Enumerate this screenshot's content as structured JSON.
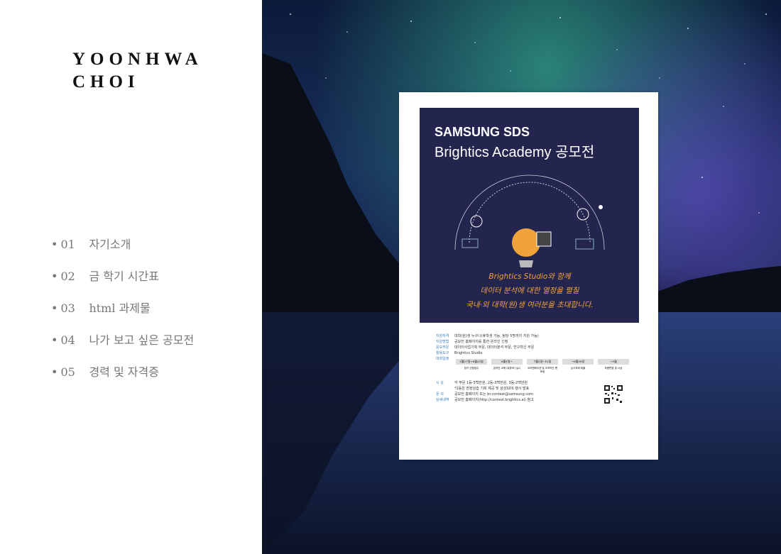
{
  "sidebar": {
    "logo_line1": "YOONHWA",
    "logo_line2": "CHOI",
    "menu": [
      {
        "bullet": "•",
        "num": "01",
        "label": "자기소개"
      },
      {
        "bullet": "•",
        "num": "02",
        "label": "금 학기 시간표"
      },
      {
        "bullet": "•",
        "num": "03",
        "label": "html 과제물"
      },
      {
        "bullet": "•",
        "num": "04",
        "label": "나가 보고 싶은 공모전"
      },
      {
        "bullet": "•",
        "num": "05",
        "label": "경력 및 자격증"
      }
    ]
  },
  "poster": {
    "brand": "SAMSUNG SDS",
    "title": "Brightics Academy 공모전",
    "slogan_line1": "Brightics Studio와 함께",
    "slogan_line2": "데이터 분석에 대한 열정을 펼칠",
    "slogan_line3": "국내·외 대학(원)생 여러분을 초대합니다.",
    "info": [
      {
        "k": "지원자격",
        "v": "대학(원)생 누구나(휴학생 가능, 팀당 5명까지 지원 가능)"
      },
      {
        "k": "지원방법",
        "v": "공모전 홈페이지를 통한 온라인 신청"
      },
      {
        "k": "응모부문",
        "v": "데이터사업기획 부문, 데이터분석 부문, 연구혁신 부문"
      },
      {
        "k": "활용도구",
        "v": "Brightics Studio"
      },
      {
        "k": "대회일정",
        "v": ""
      }
    ],
    "schedule": [
      {
        "date": "5월27일~6월25일",
        "label": "참가 신청접수"
      },
      {
        "date": "6월1일~",
        "label": "온라인 교육 (유튜브) 실시"
      },
      {
        "date": "7월2일~10일",
        "label": "오리엔테이션 및 오프라인 멘토링"
      },
      {
        "date": "~8월30일",
        "label": "심사과제 제출"
      },
      {
        "date": "~9월",
        "label": "최종면접 및 시상"
      }
    ],
    "award_k": "시 상",
    "award_v": "각 부문 1등-5백만원, 2등-3백만원, 3등-2백만원",
    "award_note": "*1등은 현장실습 기회 제공 및 삼성SDS 행사 발표",
    "contact_k": "문 의",
    "contact_v": "공모전 홈페이지 또는 br.contest@samsung.com",
    "detail_k": "상세내역",
    "detail_v": "공모전 홈페이지(http://contest.brightics.ai) 참고"
  },
  "colors": {
    "poster_bg": "#23254f",
    "slogan": "#f0a23b",
    "menu_text": "#777777"
  }
}
